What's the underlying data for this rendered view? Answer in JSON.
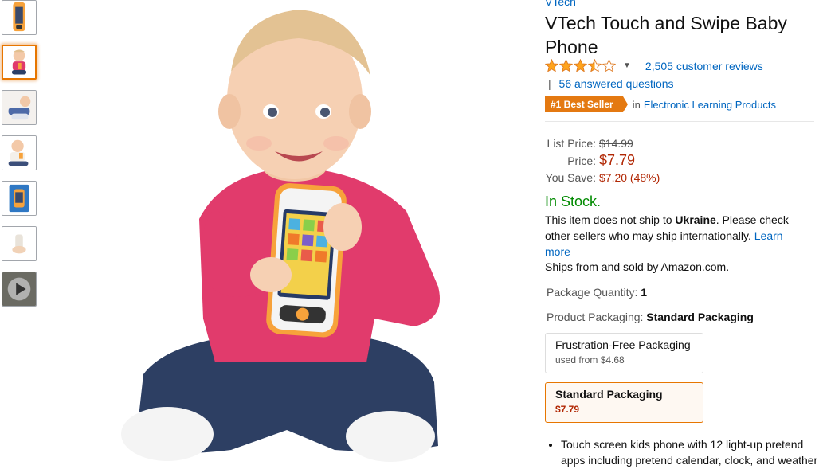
{
  "product": {
    "brand": "VTech",
    "title": "VTech Touch and Swipe Baby Phone",
    "rating": 3.5,
    "reviews_link": "2,505 customer reviews",
    "qa_separator": "|",
    "answered_questions": "56 answered questions",
    "best_seller_badge": "#1 Best Seller",
    "best_seller_in": "in",
    "best_seller_category": "Electronic Learning Products"
  },
  "pricing": {
    "list_price_label": "List Price:",
    "list_price": "$14.99",
    "price_label": "Price:",
    "price": "$7.79",
    "you_save_label": "You Save:",
    "you_save": "$7.20 (48%)"
  },
  "availability": {
    "stock": "In Stock.",
    "ship_prefix": "This item does not ship to ",
    "ship_country": "Ukraine",
    "ship_suffix": ". Please check other sellers who may ship internationally. ",
    "learn_more": "Learn more",
    "sold_by": "Ships from and sold by Amazon.com."
  },
  "variations": {
    "quantity_label": "Package Quantity:",
    "quantity_value": "1",
    "packaging_label": "Product Packaging:",
    "packaging_value": "Standard Packaging",
    "options": [
      {
        "name": "Frustration-Free Packaging",
        "sub": "used from $4.68"
      },
      {
        "name": "Standard Packaging",
        "sub": "$7.79"
      }
    ]
  },
  "features": {
    "bullet_1": "Touch screen kids phone with 12 light-up pretend apps including pretend calendar, clock, and weather"
  },
  "thumbnails": [
    "phone-product",
    "baby-holding-phone",
    "baby-lying",
    "baby-sitting",
    "package-box",
    "phone-hand",
    "video"
  ],
  "colors": {
    "link": "#0066c0",
    "price_red": "#b12704",
    "in_stock_green": "#008a00",
    "best_seller_orange": "#e47911",
    "selected_border": "#e77600",
    "star_fill": "#ffa41c"
  },
  "icons": {
    "star": "star-icon",
    "caret": "chevron-down-icon",
    "play": "play-icon"
  }
}
